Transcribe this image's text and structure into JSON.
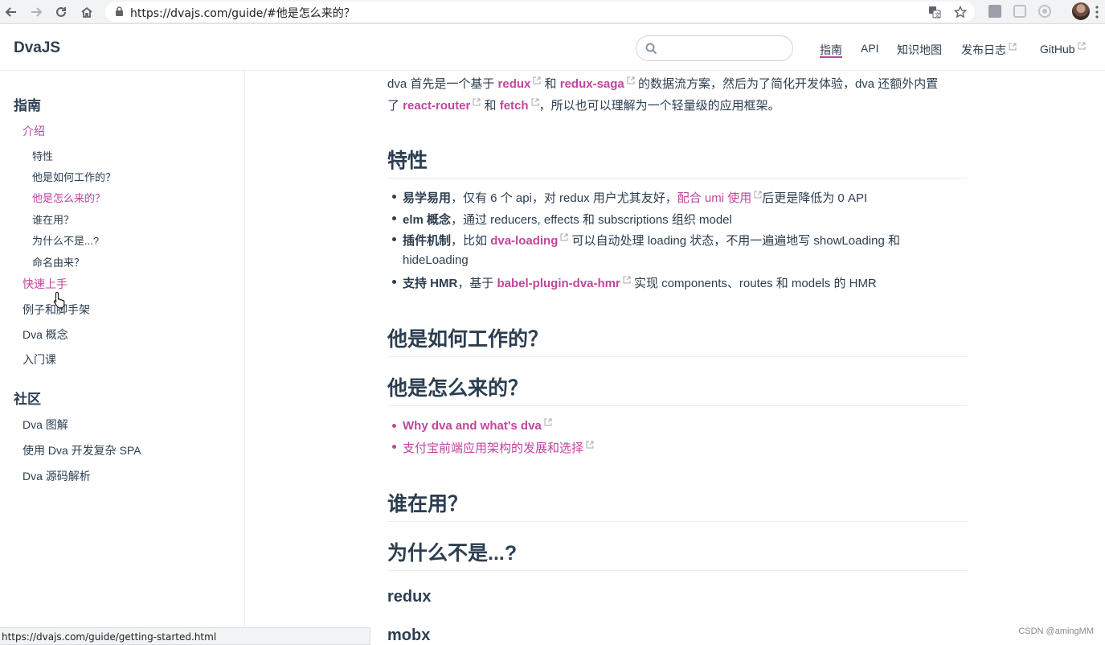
{
  "browser": {
    "url": "https://dvajs.com/guide/#他是怎么来的？",
    "status_url": "https://dvajs.com/guide/getting-started.html"
  },
  "header": {
    "site_title": "DvaJS",
    "search_placeholder": "",
    "nav": [
      {
        "label": "指南",
        "external": false,
        "active": true
      },
      {
        "label": "API",
        "external": false,
        "active": false
      },
      {
        "label": "知识地图",
        "external": false,
        "active": false
      },
      {
        "label": "发布日志",
        "external": true,
        "active": false
      },
      {
        "label": "GitHub",
        "external": true,
        "active": false
      }
    ]
  },
  "sidebar": {
    "group_guide": "指南",
    "intro": "介绍",
    "intro_children": [
      "特性",
      "他是如何工作的？",
      "他是怎么来的？",
      "谁在用？",
      "为什么不是...?",
      "命名由来？"
    ],
    "quick_start": "快速上手",
    "examples": "例子和脚手架",
    "concepts": "Dva 概念",
    "course": "入门课",
    "group_community": "社区",
    "community_items": [
      "Dva 图解",
      "使用 Dva 开发复杂 SPA",
      "Dva 源码解析"
    ]
  },
  "content": {
    "intro_line1": {
      "t1": "dva 首先是一个基于 ",
      "link1": "redux",
      "t2": " 和 ",
      "link2": "redux-saga",
      "t3": " 的数据流方案，然后为了简化开发体验，dva 还额外内置"
    },
    "intro_line2": {
      "t1": "了 ",
      "link1": "react-router",
      "t2": " 和 ",
      "link2": "fetch",
      "t3": "，所以也可以理解为一个轻量级的应用框架。"
    },
    "h_features": "特性",
    "features": {
      "f1_bold": "易学易用",
      "f1_text": "，仅有 6 个 api，对 redux 用户尤其友好，",
      "f1_link": "配合 umi 使用",
      "f1_tail": "后更是降低为 0 API",
      "f2_bold": "elm 概念",
      "f2_text": "，通过 reducers, effects 和 subscriptions 组织 model",
      "f3_bold": "插件机制",
      "f3_text": "，比如 ",
      "f3_link": "dva-loading",
      "f3_tail": " 可以自动处理 loading 状态，不用一遍遍地写 showLoading 和",
      "f3_line2": "hideLoading",
      "f4_bold": "支持 HMR",
      "f4_text": "，基于 ",
      "f4_link": "babel-plugin-dva-hmr",
      "f4_tail": " 实现 components、routes 和 models 的 HMR"
    },
    "h_how": "他是如何工作的？",
    "h_origin": "他是怎么来的？",
    "origin_links": [
      "Why dva and what's dva",
      "支付宝前端应用架构的发展和选择"
    ],
    "h_who": "谁在用？",
    "h_why_not": "为什么不是...?",
    "h_redux": "redux",
    "h_mobx": "mobx"
  },
  "watermark": "CSDN @amingMM",
  "colors": {
    "accent": "#c1459c",
    "text": "#2c3e50",
    "border": "#eaecef"
  }
}
